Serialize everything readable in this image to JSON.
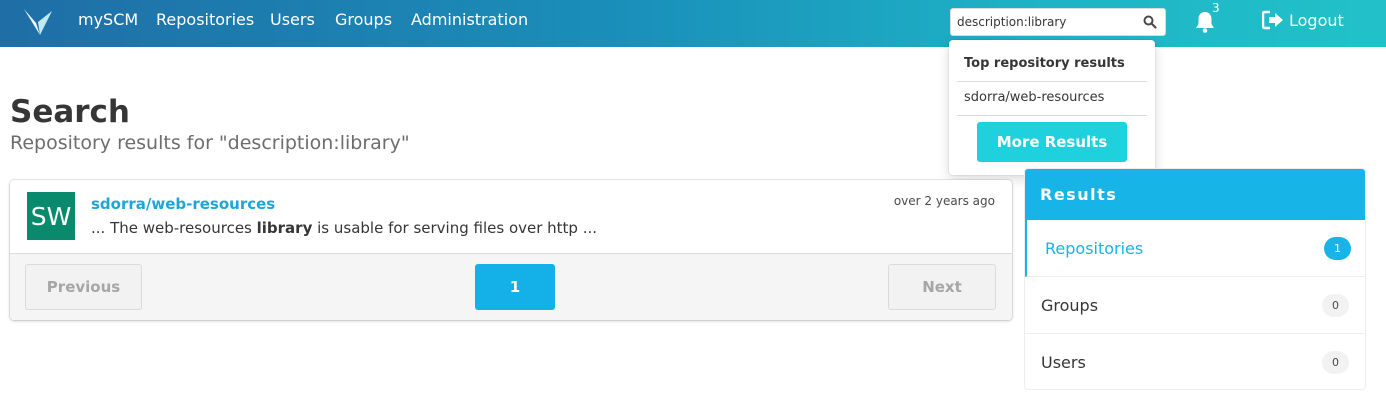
{
  "nav": {
    "brand": "mySCM",
    "links": [
      "Repositories",
      "Users",
      "Groups",
      "Administration"
    ],
    "search_value": "description:library",
    "notification_count": "3",
    "logout_label": "Logout",
    "accent": "#1eb3c6"
  },
  "dropdown": {
    "heading": "Top repository results",
    "item": "sdorra/web-resources",
    "more_label": "More Results",
    "button_color": "#1fd1dc"
  },
  "page": {
    "title": "Search",
    "subtitle": "Repository results for \"description:library\""
  },
  "results": [
    {
      "avatar": "SW",
      "name": "sdorra/web-resources",
      "desc_before": "... The web-resources ",
      "desc_highlight": "library",
      "desc_after": " is usable for serving files over http ...",
      "date": "over 2 years ago",
      "avatar_color": "#0a8a6c"
    }
  ],
  "pagination": {
    "previous": "Previous",
    "current": "1",
    "next": "Next"
  },
  "sidebar": {
    "heading": "Results",
    "items": [
      {
        "label": "Repositories",
        "count": "1",
        "active": true
      },
      {
        "label": "Groups",
        "count": "0",
        "active": false
      },
      {
        "label": "Users",
        "count": "0",
        "active": false
      }
    ],
    "accent": "#17b4e8"
  }
}
